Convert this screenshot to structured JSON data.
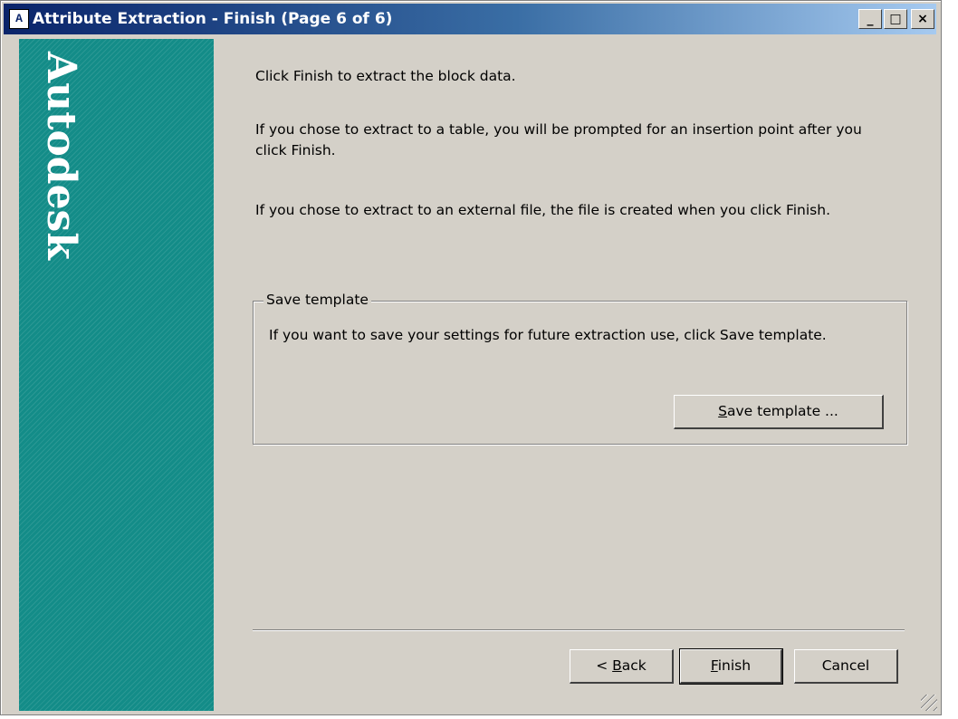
{
  "window": {
    "title": "Attribute Extraction - Finish (Page 6 of 6)",
    "app_icon": "autocad-icon",
    "controls": {
      "minimize": "_",
      "maximize": "□",
      "close": "×"
    }
  },
  "brand": {
    "text": "Autodesk"
  },
  "content": {
    "line1": "Click Finish to extract the block data.",
    "para_table": "If you chose to extract to a table, you will be prompted for an insertion point after you click Finish.",
    "para_file": "If you chose to extract to an external file, the file is created when you click Finish."
  },
  "save_template": {
    "group_title": "Save template",
    "description": "If you want to save your settings for future extraction use, click Save template.",
    "button_mnemonic": "S",
    "button_rest": "ave template ..."
  },
  "footer": {
    "back_prefix": "< ",
    "back_mnemonic": "B",
    "back_rest": "ack",
    "finish_mnemonic": "F",
    "finish_rest": "inish",
    "cancel_label": "Cancel"
  },
  "colors": {
    "brand_teal": "#138c88",
    "titlebar_start": "#0a246a",
    "titlebar_end": "#a6caf0"
  }
}
